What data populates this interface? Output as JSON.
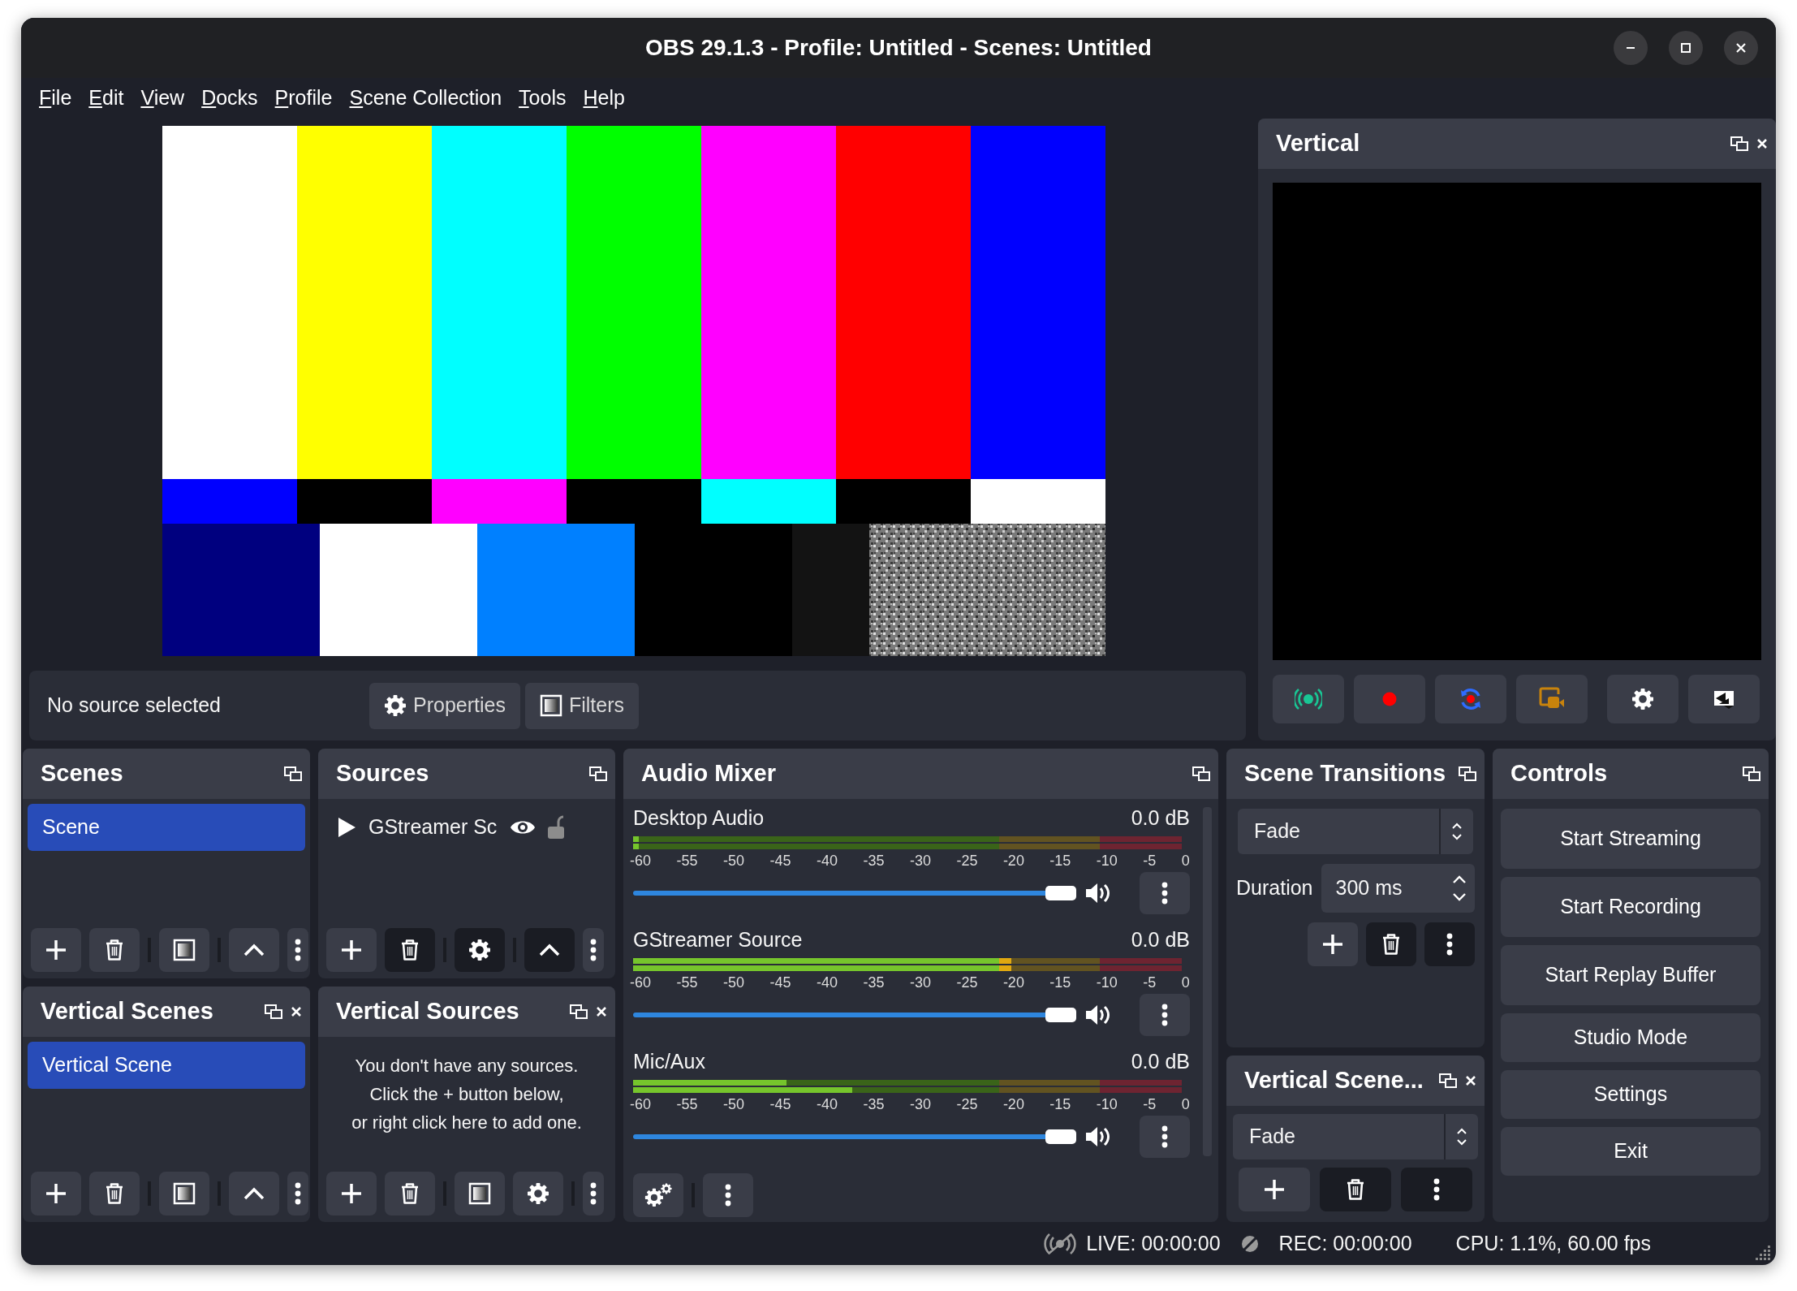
{
  "window": {
    "title": "OBS 29.1.3 - Profile: Untitled - Scenes: Untitled"
  },
  "menu": [
    {
      "label": "File"
    },
    {
      "label": "Edit"
    },
    {
      "label": "View"
    },
    {
      "label": "Docks"
    },
    {
      "label": "Profile"
    },
    {
      "label": "Scene Collection"
    },
    {
      "label": "Tools"
    },
    {
      "label": "Help"
    }
  ],
  "vertical_dock": {
    "title": "Vertical",
    "closable": true
  },
  "source_bar": {
    "status": "No source selected",
    "buttons": [
      {
        "label": "Properties",
        "kind": "properties"
      },
      {
        "label": "Filters",
        "kind": "filters"
      }
    ]
  },
  "scenes": {
    "title": "Scenes",
    "closable": false,
    "items": [
      {
        "label": "Scene",
        "selected": true
      }
    ],
    "toolbar": [
      {
        "kind": "add",
        "disabled": false
      },
      {
        "kind": "remove",
        "disabled": false
      },
      {
        "kind": "separator"
      },
      {
        "kind": "filters",
        "disabled": false
      },
      {
        "kind": "separator"
      },
      {
        "kind": "up",
        "disabled": false
      },
      {
        "kind": "menu",
        "disabled": false
      }
    ]
  },
  "sources": {
    "title": "Sources",
    "closable": false,
    "items": [
      {
        "label": "GStreamer Sc",
        "visible": true,
        "locked": false
      }
    ],
    "toolbar": [
      {
        "kind": "add",
        "disabled": false
      },
      {
        "kind": "remove",
        "disabled": true
      },
      {
        "kind": "separator"
      },
      {
        "kind": "properties",
        "disabled": true
      },
      {
        "kind": "separator"
      },
      {
        "kind": "up",
        "disabled": true
      },
      {
        "kind": "menu",
        "disabled": false
      }
    ]
  },
  "vertical_scenes": {
    "title": "Vertical Scenes",
    "closable": true,
    "items": [
      {
        "label": "Vertical Scene",
        "selected": true
      }
    ],
    "toolbar": [
      {
        "kind": "add",
        "disabled": false
      },
      {
        "kind": "remove",
        "disabled": false
      },
      {
        "kind": "separator"
      },
      {
        "kind": "filters",
        "disabled": false
      },
      {
        "kind": "separator"
      },
      {
        "kind": "up",
        "disabled": false
      },
      {
        "kind": "menu",
        "disabled": false
      }
    ]
  },
  "vertical_sources": {
    "title": "Vertical Sources",
    "closable": true,
    "empty_message": "You don't have any sources.\nClick the + button below,\nor right click here to add one.",
    "toolbar": [
      {
        "kind": "add",
        "disabled": false
      },
      {
        "kind": "remove",
        "disabled": false
      },
      {
        "kind": "separator"
      },
      {
        "kind": "filters",
        "disabled": false
      },
      {
        "kind": "properties",
        "disabled": false
      },
      {
        "kind": "separator"
      },
      {
        "kind": "menu",
        "disabled": false
      }
    ]
  },
  "audio_mixer": {
    "title": "Audio Mixer",
    "closable": false,
    "channels": [
      {
        "name": "Desktop Audio",
        "reading": "0.0 dB",
        "meters": [
          {
            "level": 0.01
          },
          {
            "level": 0.01
          }
        ],
        "scale": [
          "-60",
          "-55",
          "-50",
          "-45",
          "-40",
          "-35",
          "-30",
          "-25",
          "-20",
          "-15",
          "-10",
          "-5",
          "0"
        ],
        "volume": {
          "level": 1
        },
        "muted": false
      },
      {
        "name": "GStreamer Source",
        "reading": "0.0 dB",
        "meters": [
          {
            "level": 0.69
          },
          {
            "level": 0.69
          }
        ],
        "scale": [
          "-60",
          "-55",
          "-50",
          "-45",
          "-40",
          "-35",
          "-30",
          "-25",
          "-20",
          "-15",
          "-10",
          "-5",
          "0"
        ],
        "volume": {
          "level": 1
        },
        "muted": false
      },
      {
        "name": "Mic/Aux",
        "reading": "0.0 dB",
        "meters": [
          {
            "level": 0.28
          },
          {
            "level": 0.4
          }
        ],
        "scale": [
          "-60",
          "-55",
          "-50",
          "-45",
          "-40",
          "-35",
          "-30",
          "-25",
          "-20",
          "-15",
          "-10",
          "-5",
          "0"
        ],
        "volume": {
          "level": 1
        },
        "muted": false
      }
    ],
    "toolbar": [
      {
        "kind": "advanced",
        "disabled": false
      },
      {
        "kind": "separator"
      },
      {
        "kind": "menu",
        "disabled": false
      }
    ]
  },
  "scene_transitions": {
    "title": "Scene Transitions",
    "closable": false,
    "transition": "Fade",
    "duration_label": "Duration",
    "duration": "300 ms",
    "toolbar": [
      {
        "kind": "add",
        "disabled": false
      },
      {
        "kind": "remove",
        "disabled": true
      },
      {
        "kind": "menu",
        "disabled": true
      }
    ]
  },
  "vertical_transitions": {
    "title": "Vertical Scene...",
    "closable": true,
    "transition": "Fade",
    "toolbar": [
      {
        "kind": "add",
        "disabled": false
      },
      {
        "kind": "remove",
        "disabled": true
      },
      {
        "kind": "menu",
        "disabled": true
      }
    ]
  },
  "controls": {
    "title": "Controls",
    "closable": false,
    "buttons": [
      {
        "label": "Start Streaming"
      },
      {
        "label": "Start Recording"
      },
      {
        "label": "Start Replay Buffer"
      },
      {
        "label": "Studio Mode"
      },
      {
        "label": "Settings"
      },
      {
        "label": "Exit"
      }
    ]
  },
  "status_bar": {
    "live": "LIVE: 00:00:00",
    "rec": "REC: 00:00:00",
    "cpu": "CPU: 1.1%, 60.00 fps"
  }
}
